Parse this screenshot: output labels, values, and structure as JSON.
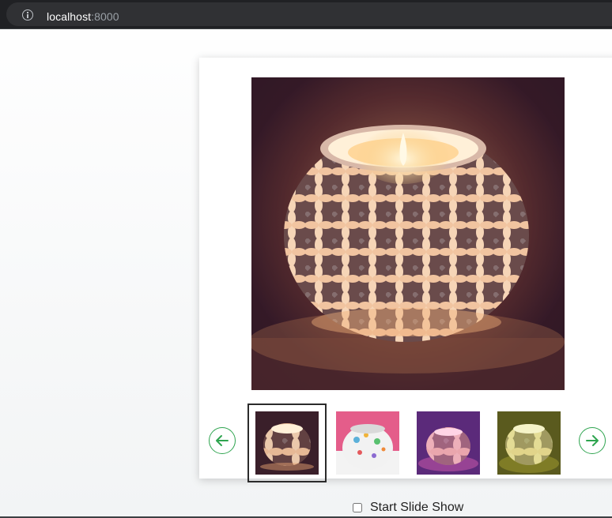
{
  "browser": {
    "url_host": "localhost",
    "url_port": ":8000",
    "info_icon": "info-icon"
  },
  "gallery": {
    "main_image": {
      "alt": "Mosaic glass candle holder with lit candle"
    },
    "thumbnails": [
      {
        "alt": "Amber flower mosaic candle holder"
      },
      {
        "alt": "White multicolor mosaic candle holder"
      },
      {
        "alt": "Pink mosaic candle holder"
      },
      {
        "alt": "Green mosaic candle holder"
      }
    ],
    "selected_index": 0,
    "prev_icon": "arrow-left-icon",
    "next_icon": "arrow-right-icon"
  },
  "slideshow": {
    "label": "Start Slide Show",
    "checked": false
  },
  "colors": {
    "accent": "#2ea44f",
    "browser_bar": "#202124"
  }
}
